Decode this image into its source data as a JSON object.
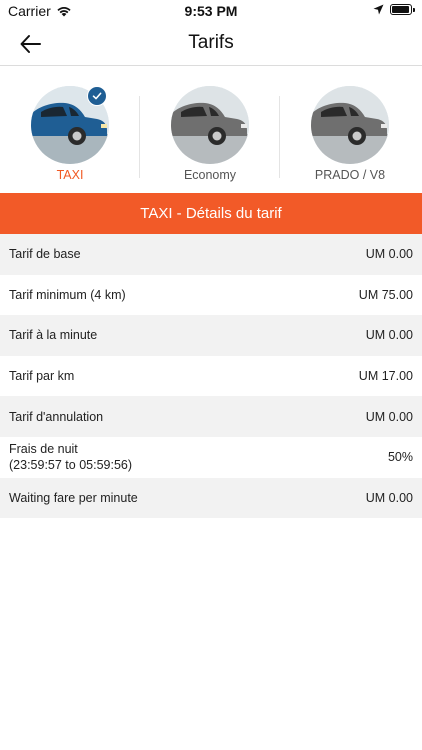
{
  "status_bar": {
    "carrier": "Carrier",
    "time": "9:53 PM"
  },
  "header": {
    "title": "Tarifs"
  },
  "vehicles": [
    {
      "label": "TAXI",
      "selected": true,
      "color": "#1f5e94"
    },
    {
      "label": "Economy",
      "selected": false,
      "color": "#6f6f6f"
    },
    {
      "label": "PRADO / V8",
      "selected": false,
      "color": "#6f6f6f"
    }
  ],
  "section": {
    "title": "TAXI - Détails du tarif"
  },
  "fares": [
    {
      "label": "Tarif de base",
      "value": "UM 0.00"
    },
    {
      "label": "Tarif minimum (4 km)",
      "value": "UM 75.00"
    },
    {
      "label": "Tarif à la minute",
      "value": "UM 0.00"
    },
    {
      "label": "Tarif par km",
      "value": "UM 17.00"
    },
    {
      "label": "Tarif d'annulation",
      "value": "UM 0.00"
    },
    {
      "label": "Frais de nuit",
      "sublabel": "(23:59:57 to 05:59:56)",
      "value": "50%"
    },
    {
      "label": "Waiting fare per minute",
      "value": "UM 0.00"
    }
  ],
  "colors": {
    "accent": "#f25a28",
    "selected_check": "#1f5e94",
    "row_alt": "#f2f2f2"
  }
}
